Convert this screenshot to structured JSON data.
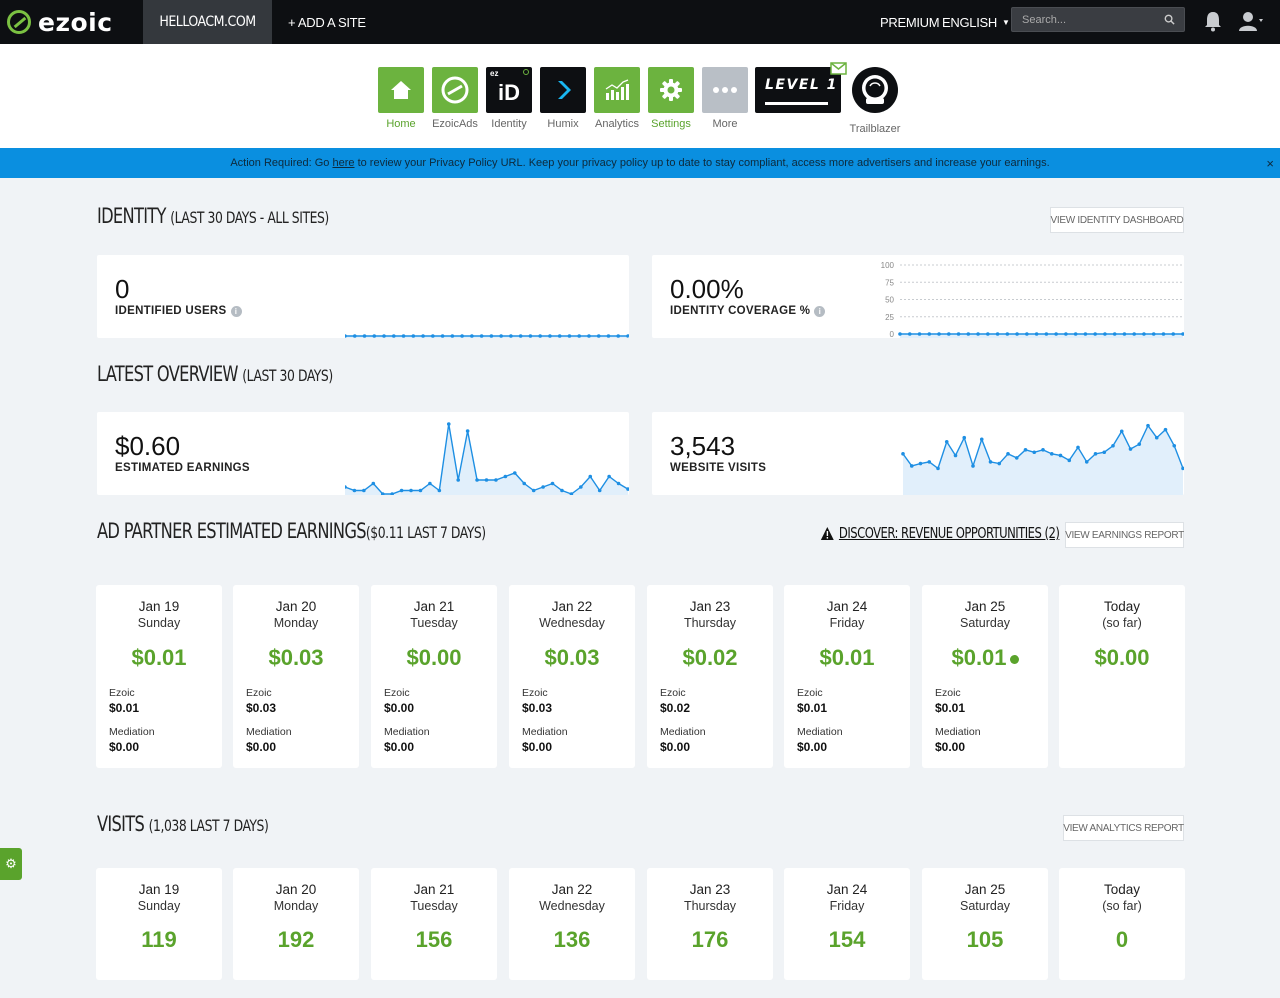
{
  "topbar": {
    "brand": "ezoic",
    "site": "HELLOACM.COM",
    "add_site": "+ ADD A SITE",
    "premium": "PREMIUM",
    "language": "ENGLISH",
    "search_placeholder": "Search..."
  },
  "apps": [
    {
      "label": "Home",
      "icon": "home-icon",
      "color": "#6cb33f",
      "active": true
    },
    {
      "label": "EzoicAds",
      "icon": "ezoicads-icon",
      "color": "#6cb33f",
      "active": false
    },
    {
      "label": "Identity",
      "icon": "identity-icon",
      "color": "#0d0f12",
      "active": false
    },
    {
      "label": "Humix",
      "icon": "humix-icon",
      "color": "#0d0f12",
      "active": false
    },
    {
      "label": "Analytics",
      "icon": "analytics-icon",
      "color": "#6cb33f",
      "active": false
    },
    {
      "label": "Settings",
      "icon": "settings-gear-icon",
      "color": "#6cb33f",
      "active": true
    },
    {
      "label": "More",
      "icon": "more-dots-icon",
      "color": "#b9bfc6",
      "active": false
    }
  ],
  "level": {
    "text": "LEVEL 1"
  },
  "trailblazer": {
    "label": "Trailblazer"
  },
  "alert": {
    "before": "Action Required: Go ",
    "link": "here",
    "after": " to review your Privacy Policy URL. Keep your privacy policy up to date to stay compliant, access more advertisers and increase your earnings.",
    "close": "×"
  },
  "identity": {
    "title": "IDENTITY",
    "subtitle": "(LAST 30 DAYS - ALL SITES)",
    "button": "VIEW IDENTITY DASHBOARD",
    "users_value": "0",
    "users_label": "IDENTIFIED USERS",
    "coverage_value": "0.00%",
    "coverage_label": "IDENTITY COVERAGE %",
    "coverage_axis": [
      "100",
      "75",
      "50",
      "25",
      "0"
    ]
  },
  "overview": {
    "title": "LATEST OVERVIEW",
    "subtitle": "(LAST 30 DAYS)",
    "earnings_value": "$0.60",
    "earnings_label": "ESTIMATED EARNINGS",
    "visits_value": "3,543",
    "visits_label": "WEBSITE VISITS"
  },
  "chart_data": [
    {
      "type": "line",
      "series": [
        {
          "values": [
            0,
            0,
            0,
            0,
            0,
            0,
            0,
            0,
            0,
            0,
            0,
            0,
            0,
            0,
            0,
            0,
            0,
            0,
            0,
            0,
            0,
            0,
            0,
            0,
            0,
            0,
            0,
            0,
            0,
            0
          ]
        }
      ]
    },
    {
      "type": "line",
      "ylim": [
        0,
        100
      ],
      "series": [
        {
          "values": [
            0,
            0,
            0,
            0,
            0,
            0,
            0,
            0,
            0,
            0,
            0,
            0,
            0,
            0,
            0,
            0,
            0,
            0,
            0,
            0,
            0,
            0,
            0,
            0,
            0,
            0,
            0,
            0,
            0,
            0
          ]
        }
      ]
    },
    {
      "type": "line",
      "series": [
        {
          "values": [
            0.01,
            0.005,
            0.005,
            0.015,
            0,
            0,
            0.005,
            0.005,
            0.005,
            0.015,
            0.005,
            0.1,
            0.02,
            0.09,
            0.02,
            0.02,
            0.02,
            0.025,
            0.03,
            0.015,
            0.005,
            0.01,
            0.015,
            0.005,
            0,
            0.01,
            0.025,
            0.005,
            0.025,
            0.015,
            0.007
          ]
        }
      ]
    },
    {
      "type": "line",
      "series": [
        {
          "values": [
            110,
            95,
            98,
            100,
            92,
            125,
            108,
            130,
            95,
            128,
            100,
            98,
            110,
            105,
            115,
            112,
            115,
            110,
            108,
            102,
            118,
            100,
            110,
            112,
            120,
            138,
            116,
            122,
            145,
            130,
            140,
            120,
            92
          ]
        }
      ]
    }
  ],
  "earnings": {
    "title": "AD PARTNER ESTIMATED EARNINGS",
    "subtitle": "($0.11 LAST 7 DAYS)",
    "discover": "DISCOVER: REVENUE OPPORTUNITIES (2)",
    "button": "VIEW EARNINGS REPORT",
    "k1": "Ezoic",
    "k2": "Mediation",
    "days": [
      {
        "date": "Jan 19",
        "dow": "Sunday",
        "total": "$0.01",
        "ezoic": "$0.01",
        "mediation": "$0.00"
      },
      {
        "date": "Jan 20",
        "dow": "Monday",
        "total": "$0.03",
        "ezoic": "$0.03",
        "mediation": "$0.00"
      },
      {
        "date": "Jan 21",
        "dow": "Tuesday",
        "total": "$0.00",
        "ezoic": "$0.00",
        "mediation": "$0.00"
      },
      {
        "date": "Jan 22",
        "dow": "Wednesday",
        "total": "$0.03",
        "ezoic": "$0.03",
        "mediation": "$0.00"
      },
      {
        "date": "Jan 23",
        "dow": "Thursday",
        "total": "$0.02",
        "ezoic": "$0.02",
        "mediation": "$0.00"
      },
      {
        "date": "Jan 24",
        "dow": "Friday",
        "total": "$0.01",
        "ezoic": "$0.01",
        "mediation": "$0.00"
      },
      {
        "date": "Jan 25",
        "dow": "Saturday",
        "total": "$0.01",
        "ezoic": "$0.01",
        "mediation": "$0.00"
      },
      {
        "date": "Today",
        "dow": "(so far)",
        "total": "$0.00"
      }
    ]
  },
  "visits": {
    "title": "VISITS",
    "subtitle": "(1,038 LAST 7 DAYS)",
    "button": "VIEW ANALYTICS REPORT",
    "days": [
      {
        "date": "Jan 19",
        "dow": "Sunday",
        "total": "119"
      },
      {
        "date": "Jan 20",
        "dow": "Monday",
        "total": "192"
      },
      {
        "date": "Jan 21",
        "dow": "Tuesday",
        "total": "156"
      },
      {
        "date": "Jan 22",
        "dow": "Wednesday",
        "total": "136"
      },
      {
        "date": "Jan 23",
        "dow": "Thursday",
        "total": "176"
      },
      {
        "date": "Jan 24",
        "dow": "Friday",
        "total": "154"
      },
      {
        "date": "Jan 25",
        "dow": "Saturday",
        "total": "105"
      },
      {
        "date": "Today",
        "dow": "(so far)",
        "total": "0"
      }
    ]
  }
}
